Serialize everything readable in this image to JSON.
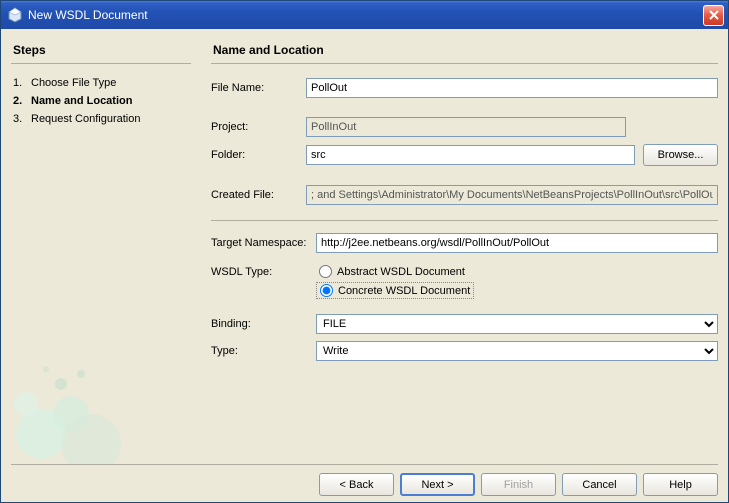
{
  "window": {
    "title": "New WSDL Document"
  },
  "sidebar": {
    "heading": "Steps",
    "steps": [
      {
        "num": "1.",
        "label": "Choose File Type"
      },
      {
        "num": "2.",
        "label": "Name and Location"
      },
      {
        "num": "3.",
        "label": "Request Configuration"
      }
    ],
    "current_index": 1
  },
  "main": {
    "heading": "Name and Location",
    "fileNameLabel": "File Name:",
    "fileName": "PollOut",
    "projectLabel": "Project:",
    "project": "PollInOut",
    "folderLabel": "Folder:",
    "folder": "src",
    "browse": "Browse...",
    "createdFileLabel": "Created File:",
    "createdFile": "; and Settings\\Administrator\\My Documents\\NetBeansProjects\\PollInOut\\src\\PollOut.wsdl",
    "targetNsLabel": "Target Namespace:",
    "targetNs": "http://j2ee.netbeans.org/wsdl/PollInOut/PollOut",
    "wsdlTypeLabel": "WSDL Type:",
    "wsdlTypeOptions": {
      "abstract": "Abstract WSDL Document",
      "concrete": "Concrete WSDL Document"
    },
    "wsdlTypeSelected": "concrete",
    "bindingLabel": "Binding:",
    "binding": "FILE",
    "typeLabel": "Type:",
    "type": "Write"
  },
  "footer": {
    "back": "< Back",
    "next": "Next >",
    "finish": "Finish",
    "cancel": "Cancel",
    "help": "Help"
  }
}
